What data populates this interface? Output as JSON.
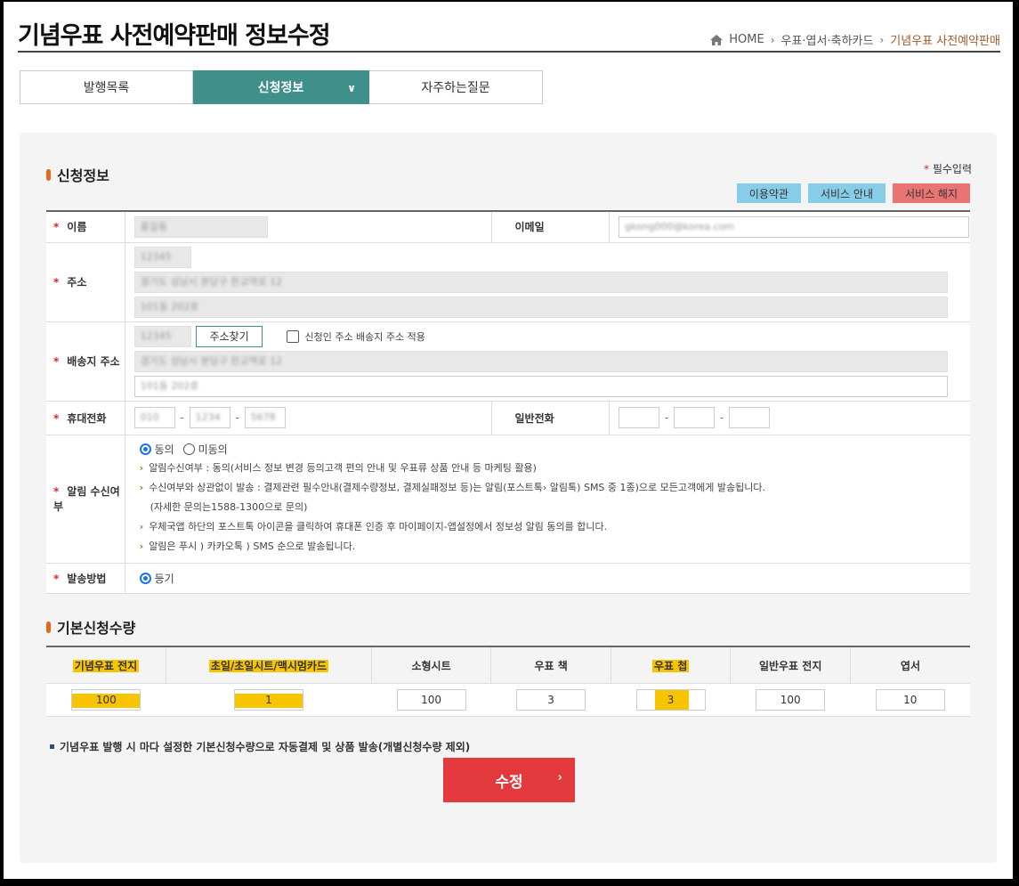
{
  "header": {
    "title": "기념우표 사전예약판매 정보수정",
    "breadcrumb": [
      "HOME",
      "우표·엽서·축하카드",
      "기념우표 사전예약판매"
    ]
  },
  "tabs": [
    {
      "label": "발행목록",
      "active": false
    },
    {
      "label": "신청정보",
      "active": true
    },
    {
      "label": "자주하는질문",
      "active": false
    }
  ],
  "section1": {
    "title": "신청정보",
    "required_note": "필수입력",
    "buttons": {
      "terms": "이용약관",
      "guide": "서비스 안내",
      "cancel": "서비스 해지"
    }
  },
  "form": {
    "name_label": "이름",
    "name_value": "홍길동",
    "email_label": "이메일",
    "email_value": "gkong000@korea.com",
    "address_label": "주소",
    "address_zip": "12345",
    "address_line1": "경기도 성남시 분당구 판교역로 12",
    "address_line2": "101동 202호",
    "ship_label": "배송지 주소",
    "ship_zip": "12345",
    "ship_find": "주소찾기",
    "ship_same_label": "신청인 주소 배송지 주소 적용",
    "ship_line1": "경기도 성남시 분당구 판교역로 12",
    "ship_line2": "101동 202호",
    "mobile_label": "휴대전화",
    "mobile_1": "010",
    "mobile_2": "1234",
    "mobile_3": "5678",
    "phone_label": "일반전화",
    "alarm_label": "알림 수신여부",
    "alarm_agree": "동의",
    "alarm_disagree": "미동의",
    "alarm_notes": [
      "알림수신여부 : 동의(서비스 정보 변경 등의고객 편의 안내 및 우표류 상품 안내 등 마케팅 활용)",
      "수신여부와 상관없이 발송 : 결제관련 필수안내(결제수량정보, 결제실패정보 등)는 알림(포스트톡› 알림톡) SMS 중 1종)으로 모든고객에게 발송됩니다.",
      "(자세한 문의는1588-1300으로 문의)",
      "우체국앱 하단의 포스트톡 아이콘을 클릭하여 휴대폰 인증 후 마이페이지-앱설정에서 정보성 알림 동의를 합니다.",
      "알림은 푸시 ) 카카오톡 ) SMS 순으로 발송됩니다."
    ],
    "delivery_label": "발송방법",
    "delivery_value": "등기"
  },
  "section2": {
    "title": "기본신청수량",
    "columns": [
      "기념우표 전지",
      "초일/초일시트/맥시멈카드",
      "소형시트",
      "우표 책",
      "우표 첩",
      "일반우표 전지",
      "엽서"
    ],
    "values": [
      "100",
      "1",
      "100",
      "3",
      "3",
      "100",
      "10"
    ]
  },
  "footnote": "기념우표 발행 시 마다 설정한 기본신청수량으로 자동결제 및 상품 발송(개별신청수량 제외)",
  "submit_label": "수정",
  "colors": {
    "accent_tab": "#3f8f8b",
    "submit": "#e3393c",
    "highlight": "#f7c400"
  }
}
